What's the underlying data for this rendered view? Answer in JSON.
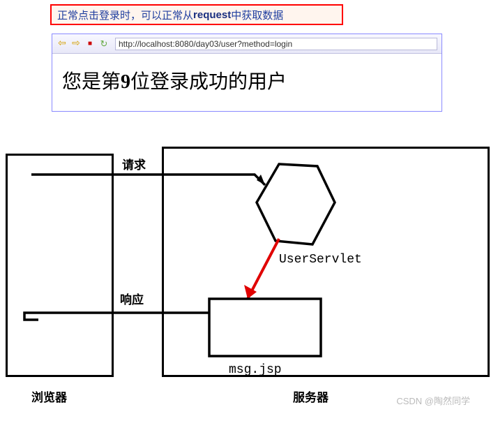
{
  "annotation": {
    "prefix": "正常点击登录时，可以正常从",
    "bold": "request",
    "suffix": "中获取数据"
  },
  "browser": {
    "url": "http://localhost:8080/day03/user?method=login",
    "content_prefix": "您是第",
    "content_num": "9",
    "content_suffix": "位登录成功的用户"
  },
  "labels": {
    "request": "请求",
    "response": "响应",
    "userservlet": "UserServlet",
    "msgjsp": "msg.jsp",
    "browser": "浏览器",
    "server": "服务器"
  },
  "watermark": "CSDN @陶然同学"
}
